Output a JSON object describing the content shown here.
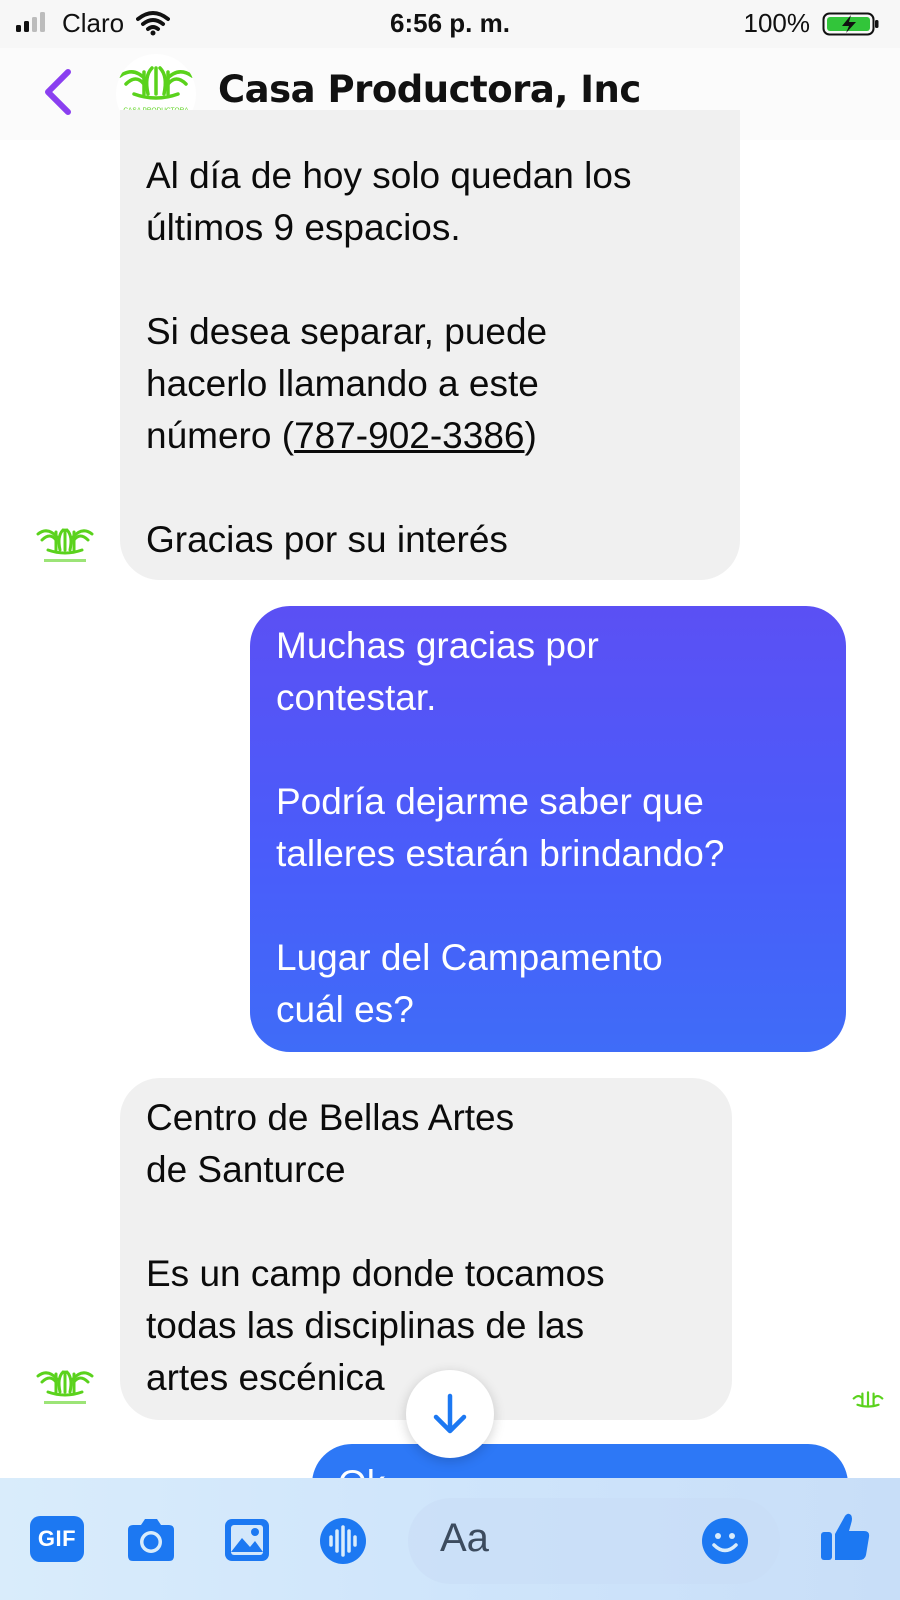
{
  "status_bar": {
    "carrier": "Claro",
    "time": "6:56 p. m.",
    "battery_percent": "100%"
  },
  "header": {
    "title": "Casa Productora, Inc",
    "logo_text": "CASA PRODUCTORA",
    "icons": [
      "back-chevron-icon",
      "contact-logo"
    ]
  },
  "messages": [
    {
      "sender": "incoming",
      "lines_before_phone": "Al día de hoy solo quedan los\núltimos 9 espacios.\n\nSi desea separar, puede\nhacerlo llamando a este\nnúmero (",
      "phone": "787-902-3386",
      "lines_after_phone": ")\n\nGracias por su interés"
    },
    {
      "sender": "outgoing",
      "text": "Muchas gracias por\ncontestar.\n\nPodría dejarme saber que\ntalleres estarán brindando?\n\nLugar del Campamento\ncuál es?"
    },
    {
      "sender": "incoming",
      "text": "Centro de Bellas Artes\nde Santurce\n\nEs un camp donde tocamos\ntodas las disciplinas de las\nartes escénica"
    },
    {
      "sender": "outgoing",
      "text": "Ok"
    }
  ],
  "composer": {
    "gif_label": "GIF",
    "placeholder": "Aa",
    "icons": [
      "gif-icon",
      "camera-icon",
      "image-icon",
      "voice-icon",
      "emoji-icon",
      "thumbs-up-icon"
    ]
  },
  "colors": {
    "accent_purple": "#8a3ff0",
    "outgoing_bubble": "#4a5cfa",
    "incoming_bubble": "#f0f0f0",
    "composer_icon": "#1c78f2",
    "logo_green": "#5ad21c"
  }
}
